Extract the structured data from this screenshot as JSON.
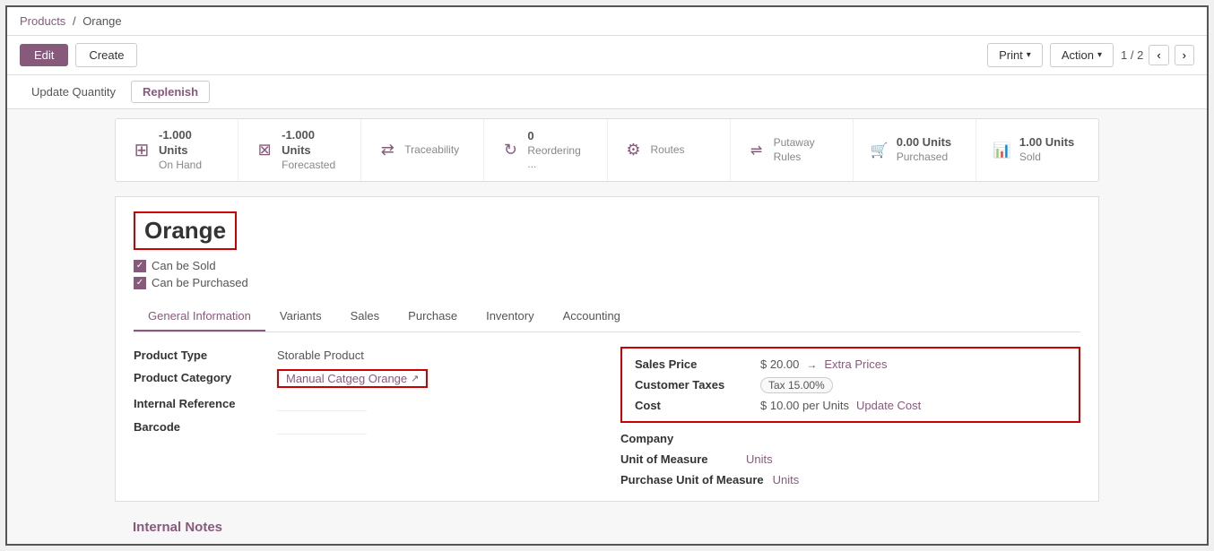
{
  "breadcrumb": {
    "parent": "Products",
    "separator": "/",
    "current": "Orange"
  },
  "toolbar": {
    "edit_label": "Edit",
    "create_label": "Create",
    "print_label": "Print",
    "action_label": "Action",
    "page_current": "1",
    "page_total": "2"
  },
  "sub_toolbar": {
    "update_qty_label": "Update Quantity",
    "replenish_label": "Replenish"
  },
  "stats": [
    {
      "id": "on-hand",
      "icon": "⊞",
      "value": "-1.000 Units",
      "label": "On Hand"
    },
    {
      "id": "forecasted",
      "icon": "⊠",
      "value": "-1.000 Units",
      "label": "Forecasted"
    },
    {
      "id": "traceability",
      "icon": "⇄",
      "value": "",
      "label": "Traceability"
    },
    {
      "id": "reordering",
      "icon": "↻",
      "value": "0",
      "label": "Reordering ..."
    },
    {
      "id": "routes",
      "icon": "⚙",
      "value": "",
      "label": "Routes"
    },
    {
      "id": "putaway",
      "icon": "⇌",
      "value": "",
      "label": "Putaway Rules"
    },
    {
      "id": "purchased",
      "icon": "🛒",
      "value": "0.00 Units",
      "label": "Purchased"
    },
    {
      "id": "sold",
      "icon": "📊",
      "value": "1.00 Units",
      "label": "Sold"
    }
  ],
  "product": {
    "name": "Orange",
    "can_be_sold": "Can be Sold",
    "can_be_purchased": "Can be Purchased"
  },
  "tabs": [
    {
      "id": "general",
      "label": "General Information",
      "active": true
    },
    {
      "id": "variants",
      "label": "Variants",
      "active": false
    },
    {
      "id": "sales",
      "label": "Sales",
      "active": false
    },
    {
      "id": "purchase",
      "label": "Purchase",
      "active": false
    },
    {
      "id": "inventory",
      "label": "Inventory",
      "active": false
    },
    {
      "id": "accounting",
      "label": "Accounting",
      "active": false
    }
  ],
  "form_left": {
    "fields": [
      {
        "label": "Product Type",
        "value": "Storable Product",
        "type": "text"
      },
      {
        "label": "Product Category",
        "value": "Manual Catgeg Orange",
        "type": "category"
      },
      {
        "label": "Internal Reference",
        "value": "",
        "type": "text"
      },
      {
        "label": "Barcode",
        "value": "",
        "type": "text"
      }
    ]
  },
  "form_right": {
    "sales_price_label": "Sales Price",
    "sales_price_value": "$ 20.00",
    "extra_prices_label": "Extra Prices",
    "customer_taxes_label": "Customer Taxes",
    "tax_badge": "Tax 15.00%",
    "cost_label": "Cost",
    "cost_value": "$ 10.00 per Units",
    "update_cost_label": "Update Cost",
    "company_label": "Company",
    "company_value": "",
    "uom_label": "Unit of Measure",
    "uom_value": "Units",
    "purchase_uom_label": "Purchase Unit of Measure",
    "purchase_uom_value": "Units"
  },
  "internal_notes": {
    "title": "Internal Notes"
  }
}
